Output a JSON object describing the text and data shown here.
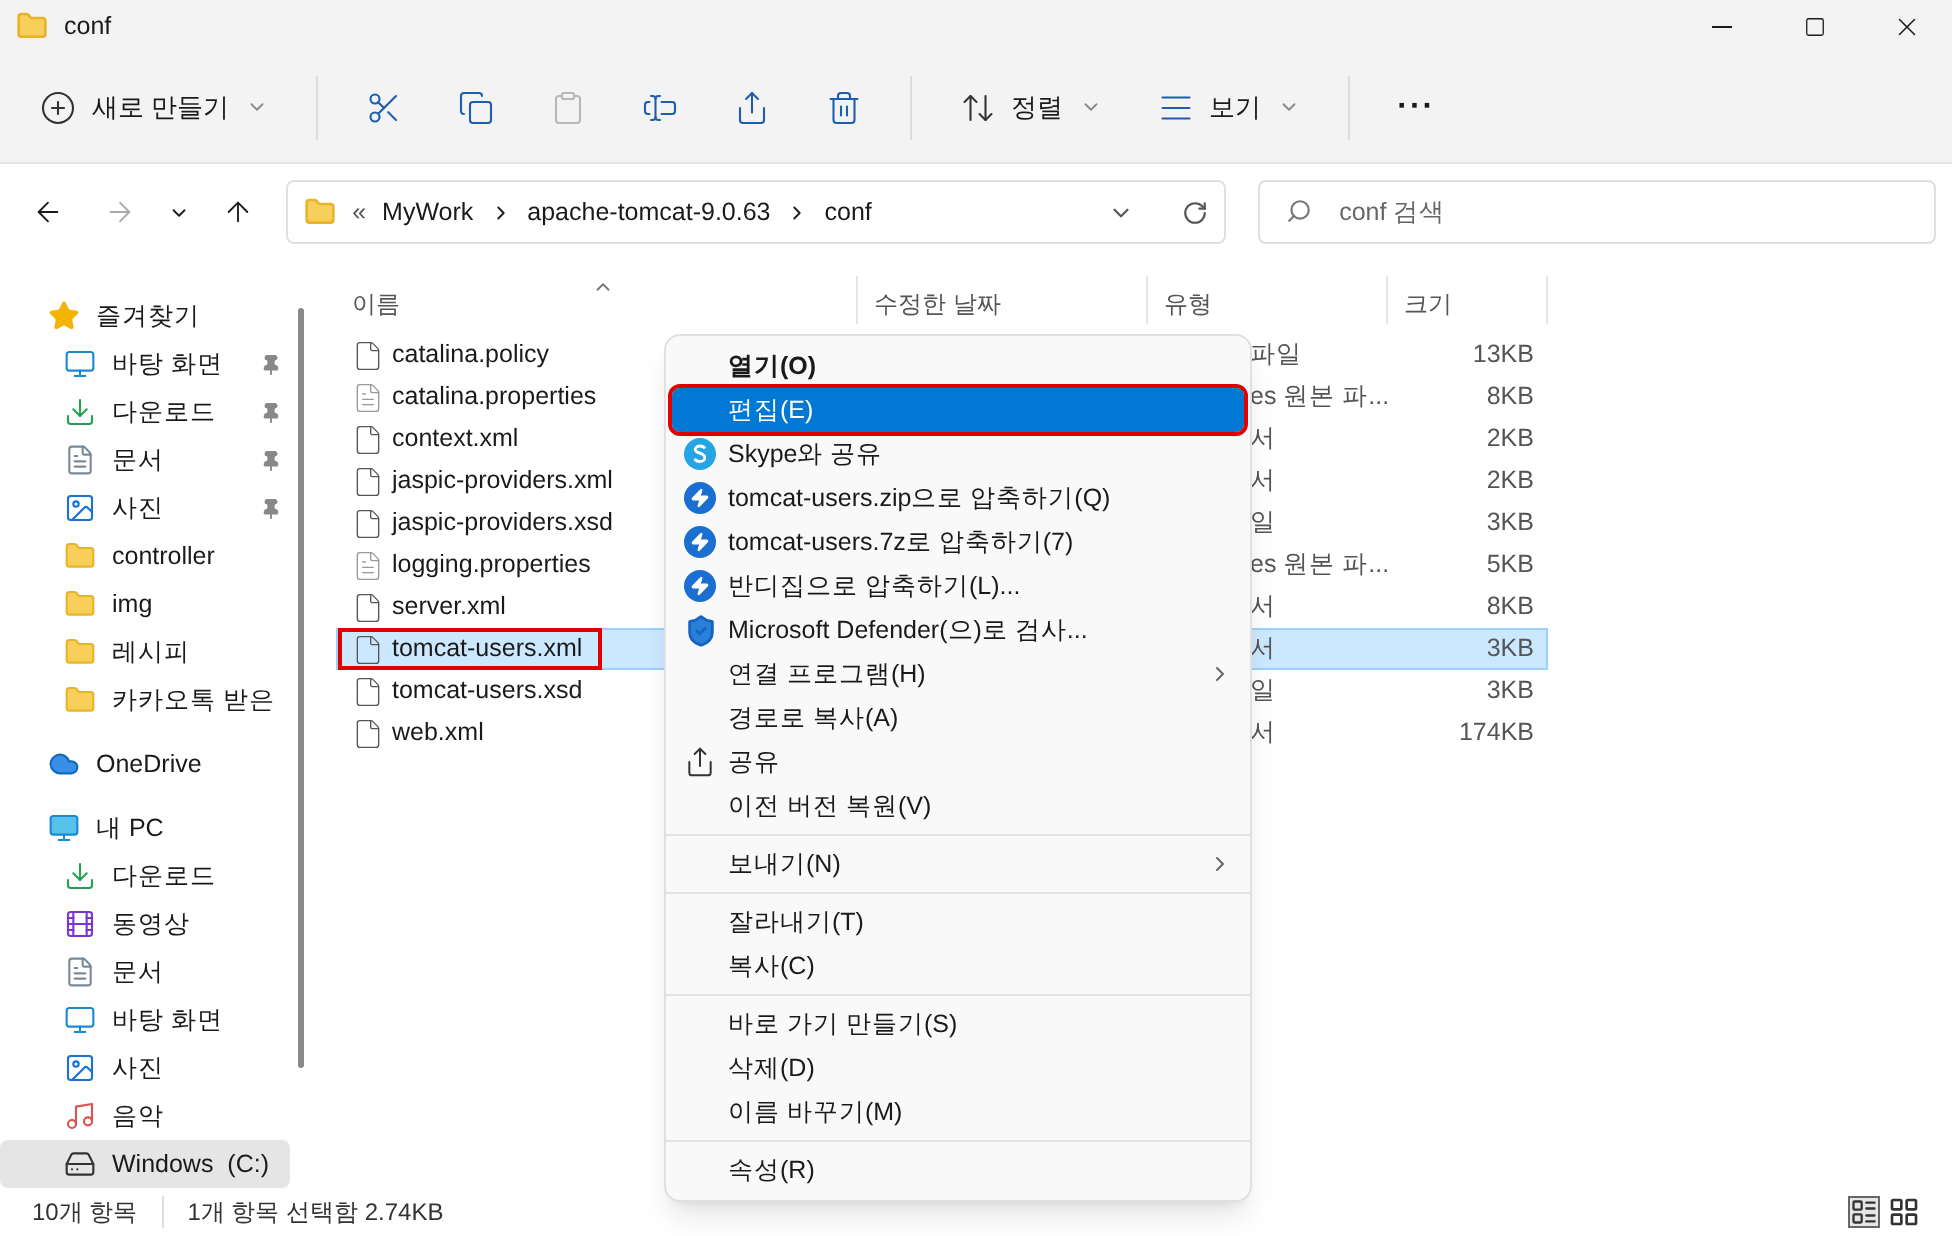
{
  "window": {
    "title": "conf"
  },
  "toolbar": [
    {
      "kind": "new",
      "label": "새로 만들기",
      "disabled": false
    },
    {
      "kind": "cut",
      "disabled": false
    },
    {
      "kind": "copy",
      "disabled": false
    },
    {
      "kind": "paste",
      "disabled": true
    },
    {
      "kind": "rename",
      "disabled": false
    },
    {
      "kind": "share",
      "disabled": false
    },
    {
      "kind": "delete",
      "disabled": false
    },
    {
      "kind": "sort",
      "label": "정렬",
      "disabled": false
    },
    {
      "kind": "view",
      "label": "보기",
      "disabled": false
    },
    {
      "kind": "more",
      "label": "···",
      "disabled": false
    }
  ],
  "address": {
    "overflow": "«",
    "crumbs": [
      "MyWork",
      "apache-tomcat-9.0.63",
      "conf"
    ]
  },
  "search": {
    "placeholder": "conf 검색"
  },
  "sidebar": [
    {
      "label": "즐겨찾기",
      "kind": "star",
      "selected": false,
      "children": [
        {
          "label": "바탕 화면",
          "kind": "desktop",
          "pinned": true,
          "selected": false
        },
        {
          "label": "다운로드",
          "kind": "download",
          "pinned": true,
          "selected": false
        },
        {
          "label": "문서",
          "kind": "document",
          "pinned": true,
          "selected": false
        },
        {
          "label": "사진",
          "kind": "picture",
          "pinned": true,
          "selected": false
        },
        {
          "label": "controller",
          "kind": "folder",
          "pinned": false,
          "selected": false
        },
        {
          "label": "img",
          "kind": "folder",
          "pinned": false,
          "selected": false
        },
        {
          "label": "레시피",
          "kind": "folder",
          "pinned": false,
          "selected": false
        },
        {
          "label": "카카오톡 받은",
          "kind": "folder",
          "pinned": false,
          "selected": false
        }
      ]
    },
    {
      "label": "OneDrive",
      "kind": "cloud",
      "selected": false
    },
    {
      "label": "내 PC",
      "kind": "pc",
      "selected": false,
      "children": [
        {
          "label": "다운로드",
          "kind": "download",
          "pinned": false,
          "selected": false
        },
        {
          "label": "동영상",
          "kind": "video",
          "pinned": false,
          "selected": false
        },
        {
          "label": "문서",
          "kind": "document",
          "pinned": false,
          "selected": false
        },
        {
          "label": "바탕 화면",
          "kind": "desktop",
          "pinned": false,
          "selected": false
        },
        {
          "label": "사진",
          "kind": "picture",
          "pinned": false,
          "selected": false
        },
        {
          "label": "음악",
          "kind": "music",
          "pinned": false,
          "selected": false
        },
        {
          "label": "Windows  (C:)",
          "kind": "drive",
          "pinned": false,
          "selected": true
        }
      ]
    }
  ],
  "table": {
    "columns": [
      "이름",
      "수정한 날짜",
      "유형",
      "크기"
    ],
    "rows": [
      {
        "name": "catalina.policy",
        "kind": "file",
        "type": "파일",
        "size": "13KB",
        "selected": false,
        "annotated": false
      },
      {
        "name": "catalina.properties",
        "kind": "text",
        "type": "es 원본 파...",
        "size": "8KB",
        "selected": false,
        "annotated": false
      },
      {
        "name": "context.xml",
        "kind": "file",
        "type": "서",
        "size": "2KB",
        "selected": false,
        "annotated": false
      },
      {
        "name": "jaspic-providers.xml",
        "kind": "file",
        "type": "서",
        "size": "2KB",
        "selected": false,
        "annotated": false
      },
      {
        "name": "jaspic-providers.xsd",
        "kind": "file",
        "type": "일",
        "size": "3KB",
        "selected": false,
        "annotated": false
      },
      {
        "name": "logging.properties",
        "kind": "text",
        "type": "es 원본 파...",
        "size": "5KB",
        "selected": false,
        "annotated": false
      },
      {
        "name": "server.xml",
        "kind": "file",
        "type": "서",
        "size": "8KB",
        "selected": false,
        "annotated": false
      },
      {
        "name": "tomcat-users.xml",
        "kind": "file",
        "type": "서",
        "size": "3KB",
        "selected": true,
        "annotated": true
      },
      {
        "name": "tomcat-users.xsd",
        "kind": "file",
        "type": "일",
        "size": "3KB",
        "selected": false,
        "annotated": false
      },
      {
        "name": "web.xml",
        "kind": "file",
        "type": "서",
        "size": "174KB",
        "selected": false,
        "annotated": false
      }
    ]
  },
  "context_menu": [
    {
      "kind": "item",
      "label": "열기(O)",
      "bold": true,
      "selected": false,
      "annotated": false
    },
    {
      "kind": "item",
      "label": "편집(E)",
      "bold": false,
      "selected": true,
      "annotated": true
    },
    {
      "kind": "skype",
      "label": "Skype와 공유",
      "selected": false,
      "annotated": false
    },
    {
      "kind": "compress",
      "label": "tomcat-users.zip으로 압축하기(Q)",
      "selected": false,
      "annotated": false
    },
    {
      "kind": "compress",
      "label": "tomcat-users.7z로 압축하기(7)",
      "selected": false,
      "annotated": false
    },
    {
      "kind": "compress",
      "label": "반디집으로 압축하기(L)...",
      "selected": false,
      "annotated": false
    },
    {
      "kind": "scan",
      "label": "Microsoft Defender(으)로 검사...",
      "selected": false,
      "annotated": false
    },
    {
      "kind": "item",
      "label": "연결 프로그램(H)",
      "submenu": true,
      "selected": false,
      "annotated": false
    },
    {
      "kind": "item",
      "label": "경로로 복사(A)",
      "selected": false,
      "annotated": false
    },
    {
      "kind": "share",
      "label": "공유",
      "selected": false,
      "annotated": false
    },
    {
      "kind": "item",
      "label": "이전 버전 복원(V)",
      "selected": false,
      "annotated": false
    },
    {
      "kind": "separator"
    },
    {
      "kind": "item",
      "label": "보내기(N)",
      "submenu": true,
      "selected": false,
      "annotated": false
    },
    {
      "kind": "separator"
    },
    {
      "kind": "item",
      "label": "잘라내기(T)",
      "selected": false,
      "annotated": false
    },
    {
      "kind": "item",
      "label": "복사(C)",
      "selected": false,
      "annotated": false
    },
    {
      "kind": "separator"
    },
    {
      "kind": "item",
      "label": "바로 가기 만들기(S)",
      "selected": false,
      "annotated": false
    },
    {
      "kind": "item",
      "label": "삭제(D)",
      "selected": false,
      "annotated": false
    },
    {
      "kind": "item",
      "label": "이름 바꾸기(M)",
      "selected": false,
      "annotated": false
    },
    {
      "kind": "separator"
    },
    {
      "kind": "item",
      "label": "속성(R)",
      "selected": false,
      "annotated": false
    }
  ],
  "status_bar": {
    "count": "10개 항목",
    "selection": "1개 항목 선택함 2.74KB"
  }
}
